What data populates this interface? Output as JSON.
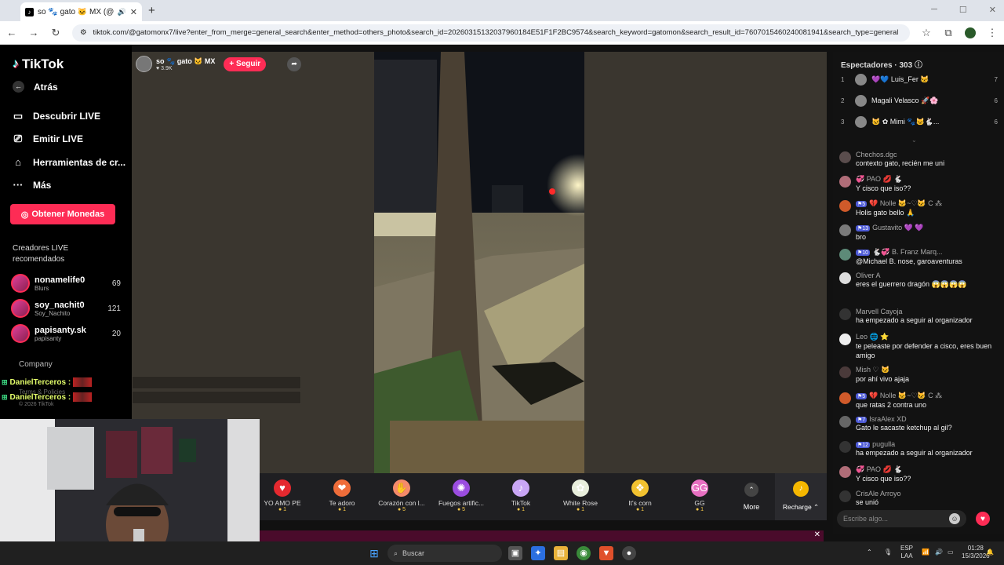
{
  "browser": {
    "tab_title": "so 🐾 gato 🐱 MX (@g...",
    "url": "tiktok.com/@gatomonx7/live?enter_from_merge=general_search&enter_method=others_photo&search_id=20260315132037960184E51F1F2BC9574&search_keyword=gatomon&search_result_id=7607015460240081941&search_type=general"
  },
  "sidebar": {
    "logo": "TikTok",
    "back": "Atrás",
    "nav": [
      "Descubrir LIVE",
      "Emitir LIVE",
      "Herramientas de cr...",
      "Más"
    ],
    "coins_button": "Obtener Monedas",
    "section_title": "Creadores LIVE recomendados",
    "creators": [
      {
        "name": "nonamelife0",
        "sub": "Blurs",
        "viewers": "69"
      },
      {
        "name": "soy_nachit0",
        "sub": "Soy_Nachito",
        "viewers": "121"
      },
      {
        "name": "papisanty.sk",
        "sub": "papisanty",
        "viewers": "20"
      }
    ],
    "company": "Company",
    "terms": "Terms & Policies",
    "copyright": "© 2026 TikTok"
  },
  "alerts": [
    "DanielTerceros :",
    "DanielTerceros :"
  ],
  "host": {
    "name": "so 🐾 gato 🐱 MX",
    "likes": "♥ 3.9K",
    "follow": "+ Seguir"
  },
  "gifts": [
    {
      "name": "YO AMO PE",
      "price": "1",
      "color": "#e5292f",
      "icon": "♥"
    },
    {
      "name": "Te adoro",
      "price": "1",
      "color": "#ef6d3a",
      "icon": "❤"
    },
    {
      "name": "Corazón con l...",
      "price": "5",
      "color": "#f58a6a",
      "icon": "✋"
    },
    {
      "name": "Fuegos artific...",
      "price": "5",
      "color": "#9b4de0",
      "icon": "✺"
    },
    {
      "name": "TikTok",
      "price": "1",
      "color": "#c9a6f5",
      "icon": "♪"
    },
    {
      "name": "White Rose",
      "price": "1",
      "color": "#e8eedc",
      "icon": "✿"
    },
    {
      "name": "It's corn",
      "price": "1",
      "color": "#f2c230",
      "icon": "❖"
    },
    {
      "name": "GG",
      "price": "1",
      "color": "#e76fc1",
      "icon": "GG"
    }
  ],
  "more_label": "More",
  "recharge_label": "Recharge ⌃",
  "panel": {
    "title": "Espectadores · 303",
    "viewers": [
      {
        "rank": "1",
        "name": "💜💙 Luis_Fer 🐱",
        "score": "7"
      },
      {
        "rank": "2",
        "name": "Magali Velasco 🚀🌸",
        "score": "6"
      },
      {
        "rank": "3",
        "name": "🐱 ✿ Mimi 🐾🐱🐇...",
        "score": "6"
      }
    ],
    "chat": [
      {
        "name": "Chechos.dgc",
        "text": "contexto gato, recién me uni",
        "color": "#5a4d4d",
        "lvl": ""
      },
      {
        "name": "💞 PAO 💋 🐇",
        "text": "Y cisco que iso??",
        "color": "#b06d78",
        "lvl": ""
      },
      {
        "name": "💔 Nolle 🐱~♡🐱 C ⁂",
        "text": "Holis gato bello 🙏",
        "color": "#d05a2a",
        "lvl": "5"
      },
      {
        "name": "Gustavito 💜 💜",
        "text": "bro",
        "color": "#7a7a7a",
        "lvl": "13"
      },
      {
        "name": "🐇💞 B. Franz Marq...",
        "text": "@Michael B. nose, garoaventuras",
        "color": "#5d8a78",
        "lvl": "10"
      },
      {
        "name": "Oliver A",
        "text": "eres el guerrero dragón 😱😱😱😱",
        "color": "#dddddd",
        "lvl": ""
      },
      {
        "name": "Marvell Cayoja",
        "text": "ha empezado a seguir al organizador",
        "color": "#333333",
        "lvl": ""
      },
      {
        "name": "Leo 🌐 ⭐",
        "text": "te peleaste por defender a cisco, eres buen amigo",
        "color": "#eeeeee",
        "lvl": ""
      },
      {
        "name": "Mish ♡ 🐱",
        "text": "por ahí vivo ajaja",
        "color": "#4a3a3a",
        "lvl": ""
      },
      {
        "name": "💔 Nolle 🐱~♡🐱 C ⁂",
        "text": "que ratas 2 contra uno",
        "color": "#d05a2a",
        "lvl": "5"
      },
      {
        "name": "IsraAlex XD",
        "text": "Gato le sacaste ketchup al gil?",
        "color": "#666666",
        "lvl": "7"
      },
      {
        "name": "pugulla",
        "text": "ha empezado a seguir al organizador",
        "color": "#333333",
        "lvl": "12"
      },
      {
        "name": "💞 PAO 💋 🐇",
        "text": "Y cisco que iso??",
        "color": "#b06d78",
        "lvl": ""
      },
      {
        "name": "CrisAle Arroyo",
        "text": "se unió",
        "color": "#333333",
        "lvl": ""
      }
    ],
    "input_placeholder": "Escribe algo..."
  },
  "taskbar": {
    "search": "Buscar",
    "lang": "ESP\nLAA",
    "time": "01:28",
    "date": "15/3/2026"
  }
}
